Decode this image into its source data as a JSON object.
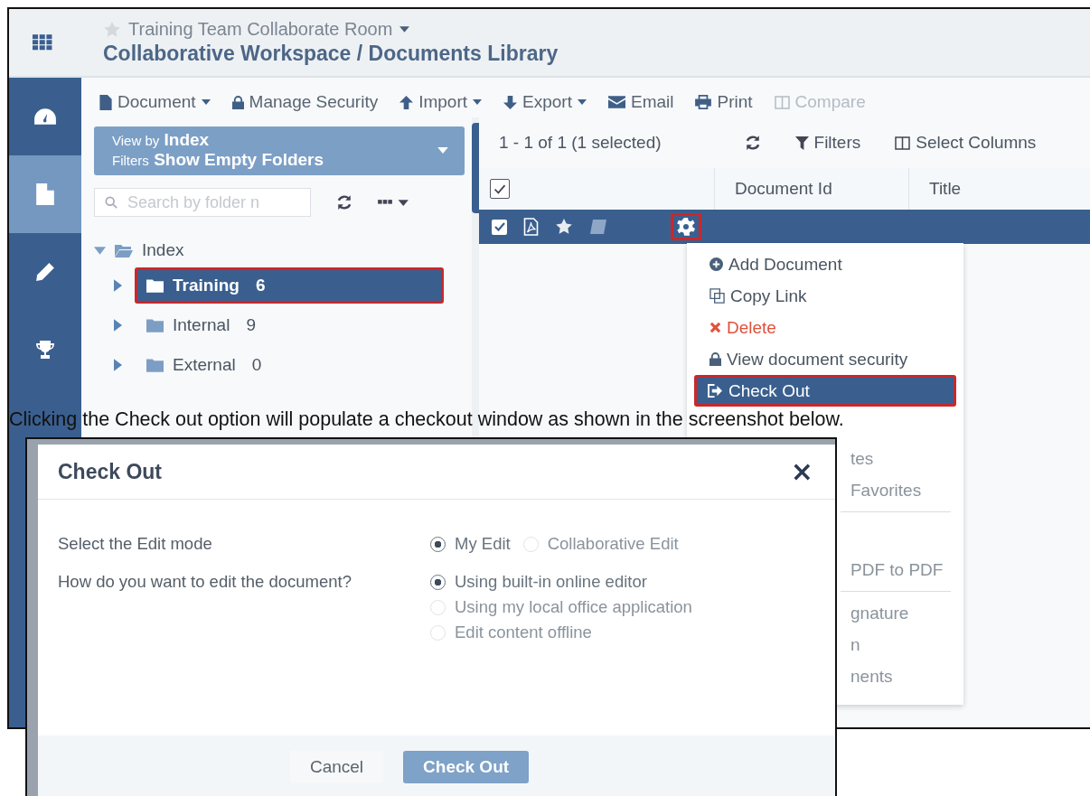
{
  "app": {
    "room": "Training Team Collaborate Room",
    "breadcrumb": "Collaborative Workspace / Documents Library",
    "nav": [
      {
        "kind": "gauge",
        "selected": false
      },
      {
        "kind": "file",
        "selected": true
      },
      {
        "kind": "pencil",
        "selected": false
      },
      {
        "kind": "trophy",
        "selected": false
      }
    ],
    "toolbar": [
      {
        "label": "Document",
        "kind": "file",
        "dropdown": true,
        "disabled": false
      },
      {
        "label": "Manage Security",
        "kind": "lock",
        "dropdown": false,
        "disabled": false
      },
      {
        "label": "Import",
        "kind": "up",
        "dropdown": true,
        "disabled": false
      },
      {
        "label": "Export",
        "kind": "down",
        "dropdown": true,
        "disabled": false
      },
      {
        "label": "Email",
        "kind": "mail",
        "dropdown": false,
        "disabled": false
      },
      {
        "label": "Print",
        "kind": "print",
        "dropdown": false,
        "disabled": false
      },
      {
        "label": "Compare",
        "kind": "columns",
        "dropdown": false,
        "disabled": true
      }
    ],
    "view_panel": {
      "view_by_label": "View by",
      "view_by": "Index",
      "filters_label": "Filters",
      "filters": "Show Empty Folders"
    },
    "folder_search": {
      "placeholder": "Search by folder n"
    },
    "tree": {
      "label": "Index",
      "expanded": true,
      "children": [
        {
          "label": "Training",
          "count": "6",
          "selected": true,
          "annotated": true
        },
        {
          "label": "Internal",
          "count": "9",
          "selected": false,
          "annotated": false
        },
        {
          "label": "External",
          "count": "0",
          "selected": false,
          "annotated": false
        }
      ]
    },
    "results": {
      "count": "1 - 1 of 1 (1 selected)",
      "actions": [
        {
          "label": "Filters",
          "kind": "filter"
        },
        {
          "label": "Select Columns",
          "kind": "columns"
        }
      ]
    },
    "table": {
      "columns": [
        "Document Id",
        "Title"
      ],
      "header_checked": true,
      "rows": [
        {
          "checked": true,
          "selected": true,
          "gear_annotated": true
        }
      ]
    },
    "context_menu": [
      {
        "label": "Add Document",
        "kind": "add",
        "selected": false,
        "annotated": false
      },
      {
        "label": "Copy Link",
        "kind": "copy",
        "selected": false,
        "annotated": false
      },
      {
        "label": "Delete",
        "kind": "delete",
        "selected": false,
        "annotated": false
      },
      {
        "label": "View document security",
        "kind": "lock",
        "selected": false,
        "annotated": false
      },
      {
        "label": "Check Out",
        "kind": "checkout",
        "selected": true,
        "annotated": true
      },
      {
        "kind": "gap"
      },
      {
        "label": "tes",
        "kind": "partial",
        "selected": false,
        "annotated": false
      },
      {
        "label": "Favorites",
        "kind": "partial",
        "selected": false,
        "annotated": false
      },
      {
        "kind": "divider"
      },
      {
        "kind": "gap"
      },
      {
        "label": "PDF to PDF",
        "kind": "partial",
        "selected": false,
        "annotated": false
      },
      {
        "kind": "divider"
      },
      {
        "label": "gnature",
        "kind": "partial",
        "selected": false,
        "annotated": false
      },
      {
        "label": "n",
        "kind": "partial",
        "selected": false,
        "annotated": false
      },
      {
        "label": "nents",
        "kind": "partial",
        "selected": false,
        "annotated": false
      }
    ]
  },
  "caption": "Clicking the Check out option will populate a checkout window as shown in the screenshot below.",
  "dialog": {
    "title": "Check Out",
    "close": "×",
    "fields": [
      {
        "label": "Select the Edit mode",
        "kind": "inline",
        "options": [
          {
            "label": "My Edit",
            "selected": true
          },
          {
            "label": "Collaborative Edit",
            "selected": false
          }
        ]
      },
      {
        "label": "How do you want to edit the document?",
        "kind": "stacked",
        "options": [
          {
            "label": "Using built-in online editor",
            "selected": true
          },
          {
            "label": "Using my local office application",
            "selected": false
          },
          {
            "label": "Edit content offline",
            "selected": false
          }
        ]
      }
    ],
    "buttons": [
      {
        "label": "Cancel",
        "kind": "secondary"
      },
      {
        "label": "Check Out",
        "kind": "primary"
      }
    ]
  }
}
